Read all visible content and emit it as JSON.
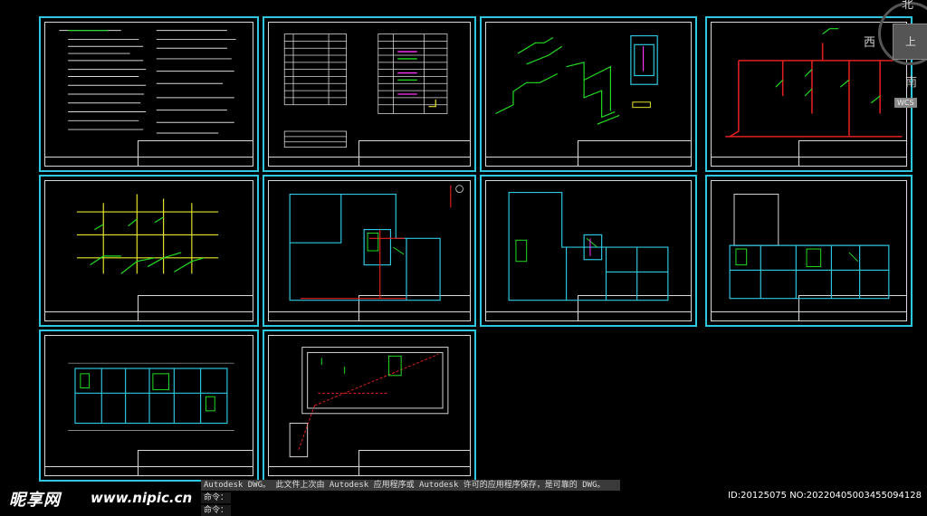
{
  "viewcube": {
    "north": "北",
    "west": "西",
    "south": "南",
    "face": "上",
    "wcs": "WCS"
  },
  "command": {
    "message": "Autodesk DWG。  此文件上次由 Autodesk 应用程序或 Autodesk 许可的应用程序保存，是可靠的 DWG。",
    "prompt1": "命令：",
    "prompt2": "命令："
  },
  "watermark": {
    "logo": "昵享网",
    "url": "www.nipic.cn",
    "id": "ID:20125075 NO:20220405003455094128"
  },
  "colors": {
    "sheet_border": "#2ec7e0",
    "wall": "#2ec7e0",
    "pipe_red": "#e02020",
    "pipe_green": "#22dd22",
    "pipe_yellow": "#e6e62a",
    "text_white": "#d8d8d8",
    "text_magenta": "#ff33ff"
  },
  "sheets": [
    {
      "name": "sheet-design-notes"
    },
    {
      "name": "sheet-legend-tables"
    },
    {
      "name": "sheet-pipe-axonometric-1"
    },
    {
      "name": "sheet-pipe-system-red"
    },
    {
      "name": "sheet-riser-diagram"
    },
    {
      "name": "sheet-floor-plan-1"
    },
    {
      "name": "sheet-floor-plan-2"
    },
    {
      "name": "sheet-floor-plan-3"
    },
    {
      "name": "sheet-floor-plan-4"
    },
    {
      "name": "sheet-roof-plan"
    }
  ]
}
